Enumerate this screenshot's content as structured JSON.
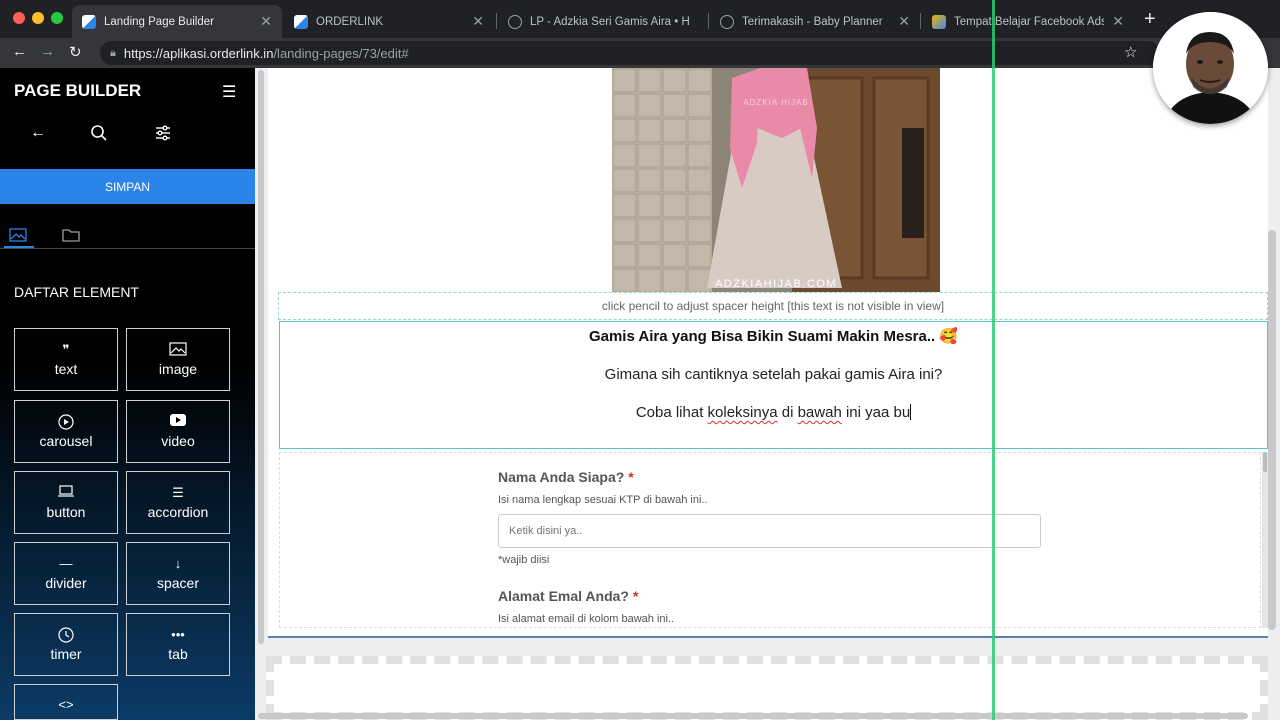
{
  "browser": {
    "tabs": [
      {
        "title": "Landing Page Builder",
        "active": true
      },
      {
        "title": "ORDERLINK",
        "active": false
      },
      {
        "title": "LP - Adzkia Seri Gamis Aira • H",
        "active": false
      },
      {
        "title": "Terimakasih - Baby Planner",
        "active": false
      },
      {
        "title": "Tempat Belajar Facebook Ads d",
        "active": false
      }
    ],
    "url_host": "https://aplikasi.orderlink.in",
    "url_path": "/landing-pages/73/edit#"
  },
  "sidebar": {
    "title": "PAGE BUILDER",
    "save_label": "SIMPAN",
    "section_title": "DAFTAR ELEMENT",
    "elements": [
      {
        "label": "text",
        "icon": "quote-icon"
      },
      {
        "label": "image",
        "icon": "image-icon"
      },
      {
        "label": "carousel",
        "icon": "play-circle-icon"
      },
      {
        "label": "video",
        "icon": "youtube-icon"
      },
      {
        "label": "button",
        "icon": "laptop-icon"
      },
      {
        "label": "accordion",
        "icon": "list-icon"
      },
      {
        "label": "divider",
        "icon": "minus-icon"
      },
      {
        "label": "spacer",
        "icon": "arrow-down-icon"
      },
      {
        "label": "timer",
        "icon": "clock-icon"
      },
      {
        "label": "tab",
        "icon": "dots-icon"
      }
    ]
  },
  "canvas": {
    "image_watermark": "ADZKIAHIJAB.COM",
    "image_watermark_top": "ADZKIA HIJAB",
    "spacer_hint": "click pencil to adjust spacer height [this text is not visible in view]",
    "text_block": {
      "heading": "Gamis Aira yang Bisa Bikin Suami Makin Mesra.. 🥰",
      "line1": "Gimana sih cantiknya setelah pakai gamis Aira ini?",
      "line2_a": "Coba lihat ",
      "line2_spell1": "koleksinya",
      "line2_b": " di ",
      "line2_spell2": "bawah",
      "line2_c": " ini yaa bu"
    },
    "form": {
      "field1_label": "Nama Anda Siapa?",
      "field1_help": "Isi nama lengkap sesuai KTP di bawah ini..",
      "field1_placeholder": "Ketik disini ya..",
      "field1_note": "*wajib diisi",
      "field2_label": "Alamat Emal Anda?",
      "field2_help": "Isi alamat email di kolom bawah ini..",
      "required_mark": "*"
    }
  },
  "colors": {
    "accent": "#2b84e8",
    "guide_line": "#2ecc71",
    "required": "#d93025"
  }
}
